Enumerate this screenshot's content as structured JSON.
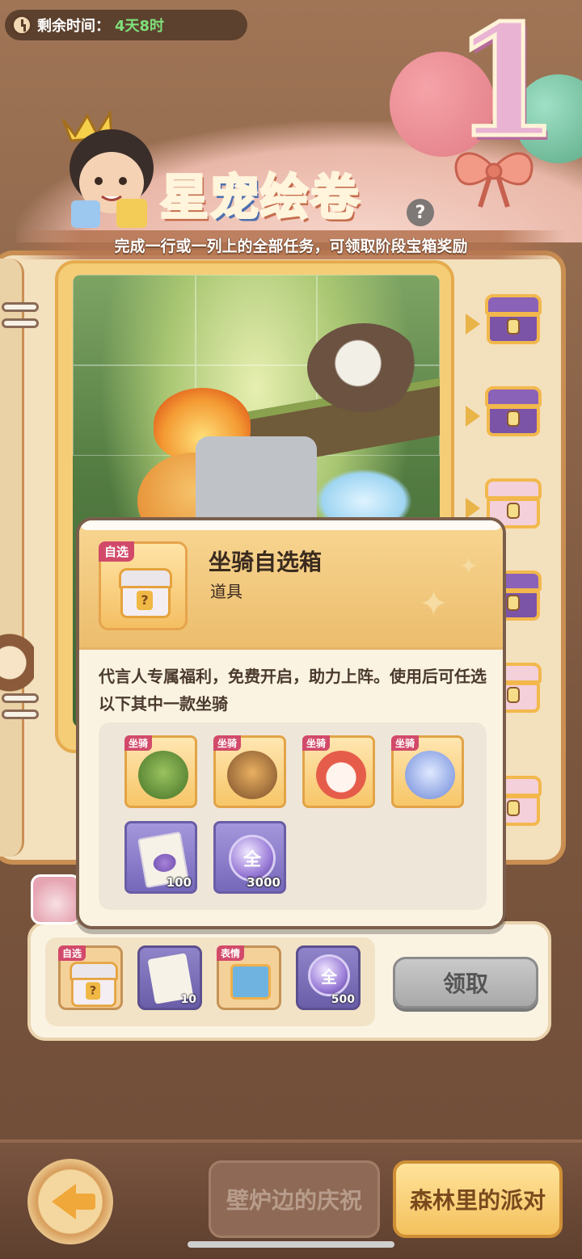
{
  "top_bar": {
    "timer_label": "剩余时间：",
    "timer_value": "4天8时",
    "clock_icon": "clock-icon"
  },
  "header": {
    "title_part1": "星",
    "title_part2": "宠",
    "title_part3": "绘卷",
    "badge_number": "1",
    "help_label": "?",
    "subtitle": "完成一行或一列上的全部任务，可领取阶段宝箱奖励"
  },
  "stage_chests": [
    {
      "icon": "treasure-chest-icon",
      "style": "purple"
    },
    {
      "icon": "treasure-chest-icon",
      "style": "purple"
    },
    {
      "icon": "cake-chest-icon",
      "style": "cake"
    },
    {
      "icon": "treasure-chest-icon",
      "style": "purple"
    },
    {
      "icon": "cake-chest-icon",
      "style": "cake"
    },
    {
      "icon": "cake-icon",
      "style": "cake"
    }
  ],
  "reward_row": {
    "items": [
      {
        "tag": "自选",
        "icon": "mount-chest-icon",
        "qty": ""
      },
      {
        "tag": "",
        "icon": "integral-card-icon",
        "qty": "10"
      },
      {
        "tag": "表情",
        "icon": "emote-box-icon",
        "qty": ""
      },
      {
        "tag": "",
        "icon": "quan-coin-icon",
        "qty": "500"
      }
    ],
    "claim_label": "领取"
  },
  "popup": {
    "item_tag": "自选",
    "item_name": "坐骑自选箱",
    "item_type": "道具",
    "description": "代言人专属福利，免费开启，助力上阵。使用后可任选以下其中一款坐骑",
    "options": [
      {
        "tag": "坐骑",
        "icon": "green-bush-mount-icon",
        "qty": ""
      },
      {
        "tag": "坐骑",
        "icon": "pilot-bird-mount-icon",
        "qty": ""
      },
      {
        "tag": "坐骑",
        "icon": "lion-dance-mount-icon",
        "qty": ""
      },
      {
        "tag": "坐骑",
        "icon": "blue-ghost-mount-icon",
        "qty": ""
      },
      {
        "tag": "",
        "icon": "integral-card-icon",
        "qty": "100"
      },
      {
        "tag": "",
        "icon": "quan-coin-icon",
        "coin_text": "全",
        "qty": "3000"
      }
    ],
    "colors": {
      "tag_bg": "#d24a6a",
      "card_top": "#f8d692"
    }
  },
  "reward_coin_text": "全",
  "bottom_nav": {
    "tab_inactive": "壁炉边的庆祝",
    "tab_active": "森林里的派对",
    "back_icon": "back-arrow-icon"
  }
}
